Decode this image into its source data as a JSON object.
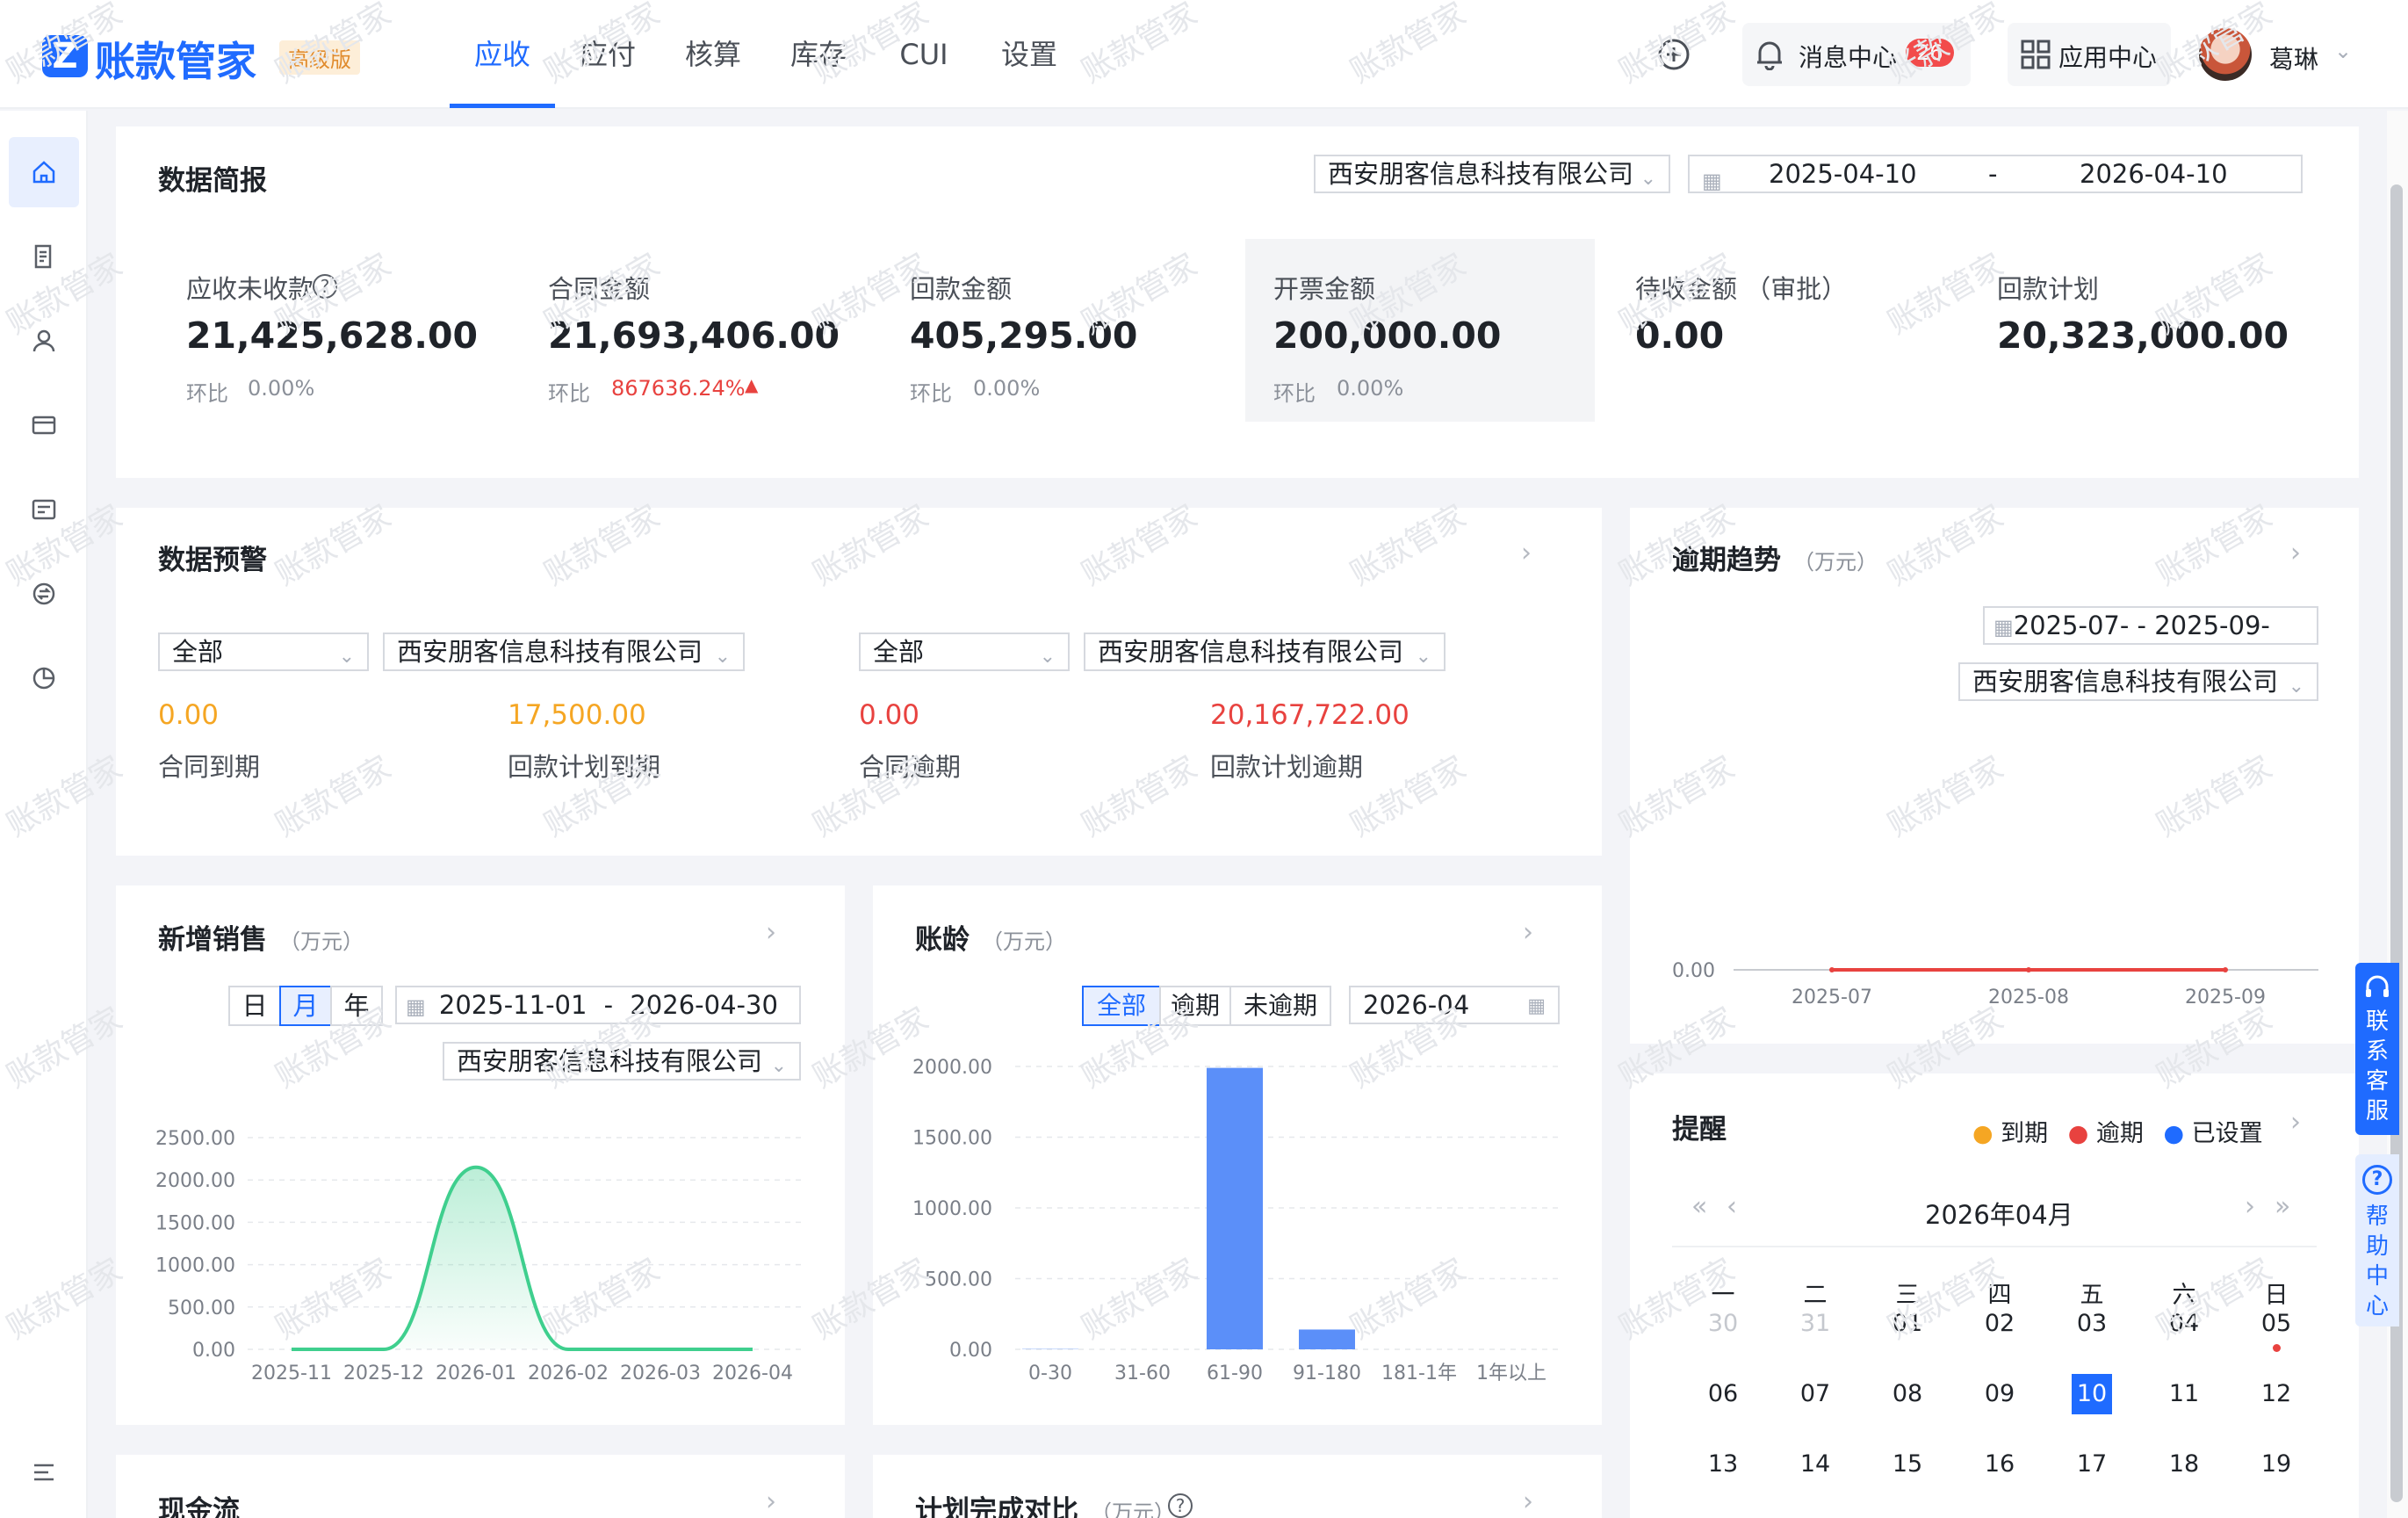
{
  "app": {
    "name": "账款管家",
    "edition": "高级版"
  },
  "nav": {
    "tabs": [
      "应收",
      "应付",
      "核算",
      "库存",
      "CUI",
      "设置"
    ],
    "active": 0
  },
  "header": {
    "message_center": "消息中心",
    "message_count": "26",
    "app_center": "应用中心",
    "user_name": "葛琳"
  },
  "watermark": "账款管家",
  "summary": {
    "title": "数据简报",
    "company": "西安朋客信息科技有限公司",
    "date_start": "2025-04-10",
    "date_sep": "-",
    "date_end": "2026-04-10",
    "metrics": [
      {
        "label": "应收未收款",
        "value": "21,425,628.00",
        "ratio_label": "环比",
        "ratio": "0.00%"
      },
      {
        "label": "合同金额",
        "value": "21,693,406.00",
        "ratio_label": "环比",
        "ratio": "867636.24%"
      },
      {
        "label": "回款金额",
        "value": "405,295.00",
        "ratio_label": "环比",
        "ratio": "0.00%"
      },
      {
        "label": "开票金额",
        "value": "200,000.00",
        "ratio_label": "环比",
        "ratio": "0.00%"
      },
      {
        "label": "待收金额 （审批）",
        "value": "0.00"
      },
      {
        "label": "回款计划",
        "value": "20,323,000.00"
      }
    ]
  },
  "warning": {
    "title": "数据预警",
    "filter1": "全部",
    "company1": "西安朋客信息科技有限公司",
    "filter2": "全部",
    "company2": "西安朋客信息科技有限公司",
    "items": [
      {
        "value": "0.00",
        "label": "合同到期",
        "color": "#f5a623"
      },
      {
        "value": "17,500.00",
        "label": "回款计划到期",
        "color": "#f5a623"
      },
      {
        "value": "0.00",
        "label": "合同逾期",
        "color": "#e8423f"
      },
      {
        "value": "20,167,722.00",
        "label": "回款计划逾期",
        "color": "#e8423f"
      }
    ]
  },
  "overdue": {
    "title": "逾期趋势",
    "unit": "（万元）",
    "date_range": "2025-07- - 2025-09-",
    "company": "西安朋客信息科技有限公司"
  },
  "sales": {
    "title": "新增销售",
    "unit": "（万元）",
    "period_tabs": [
      "日",
      "月",
      "年"
    ],
    "date_start": "2025-11-01",
    "date_sep": "-",
    "date_end": "2026-04-30",
    "company": "西安朋客信息科技有限公司"
  },
  "aging": {
    "title": "账龄",
    "unit": "（万元）",
    "filter_tabs": [
      "全部",
      "逾期",
      "未逾期"
    ],
    "month": "2026-04"
  },
  "reminder": {
    "title": "提醒",
    "legend": [
      {
        "label": "到期",
        "color": "#f5a623"
      },
      {
        "label": "逾期",
        "color": "#e8423f"
      },
      {
        "label": "已设置",
        "color": "#1f6bff"
      }
    ],
    "month": "2026年04月",
    "weekdays": [
      "一",
      "二",
      "三",
      "四",
      "五",
      "六",
      "日"
    ],
    "weeks": [
      [
        "30",
        "31",
        "01",
        "02",
        "03",
        "04",
        "05"
      ],
      [
        "06",
        "07",
        "08",
        "09",
        "10",
        "11",
        "12"
      ],
      [
        "13",
        "14",
        "15",
        "16",
        "17",
        "18",
        "19"
      ]
    ],
    "selected_day": "10",
    "dot_day": "05"
  },
  "bottom": {
    "cashflow": "现金流",
    "plan_compare": "计划完成对比",
    "plan_unit": "（万元）"
  },
  "float": {
    "support": "联系客服",
    "help": "帮助中心"
  },
  "chart_data": [
    {
      "type": "line",
      "title": "逾期趋势",
      "x": [
        "2025-07",
        "2025-08",
        "2025-09"
      ],
      "series": [
        {
          "values": [
            0,
            0,
            0
          ],
          "color": "#e8423f"
        }
      ],
      "yticks": [
        "0.00"
      ]
    },
    {
      "type": "area",
      "title": "新增销售",
      "x": [
        "2025-11",
        "2025-12",
        "2026-01",
        "2026-02",
        "2026-03",
        "2026-04"
      ],
      "series": [
        {
          "values": [
            0,
            0,
            2150,
            0,
            0,
            0
          ],
          "color": "#3fcf8e"
        }
      ],
      "ylim": [
        0,
        2500
      ],
      "yticks": [
        "0.00",
        "500.00",
        "1000.00",
        "1500.00",
        "2000.00",
        "2500.00"
      ]
    },
    {
      "type": "bar",
      "title": "账龄",
      "categories": [
        "0-30",
        "31-60",
        "61-90",
        "91-180",
        "181-1年",
        "1年以上"
      ],
      "values": [
        2,
        0,
        1990,
        140,
        0,
        0
      ],
      "ylim": [
        0,
        2000
      ],
      "yticks": [
        "0.00",
        "500.00",
        "1000.00",
        "1500.00",
        "2000.00"
      ],
      "color": "#5b8ff9"
    }
  ]
}
